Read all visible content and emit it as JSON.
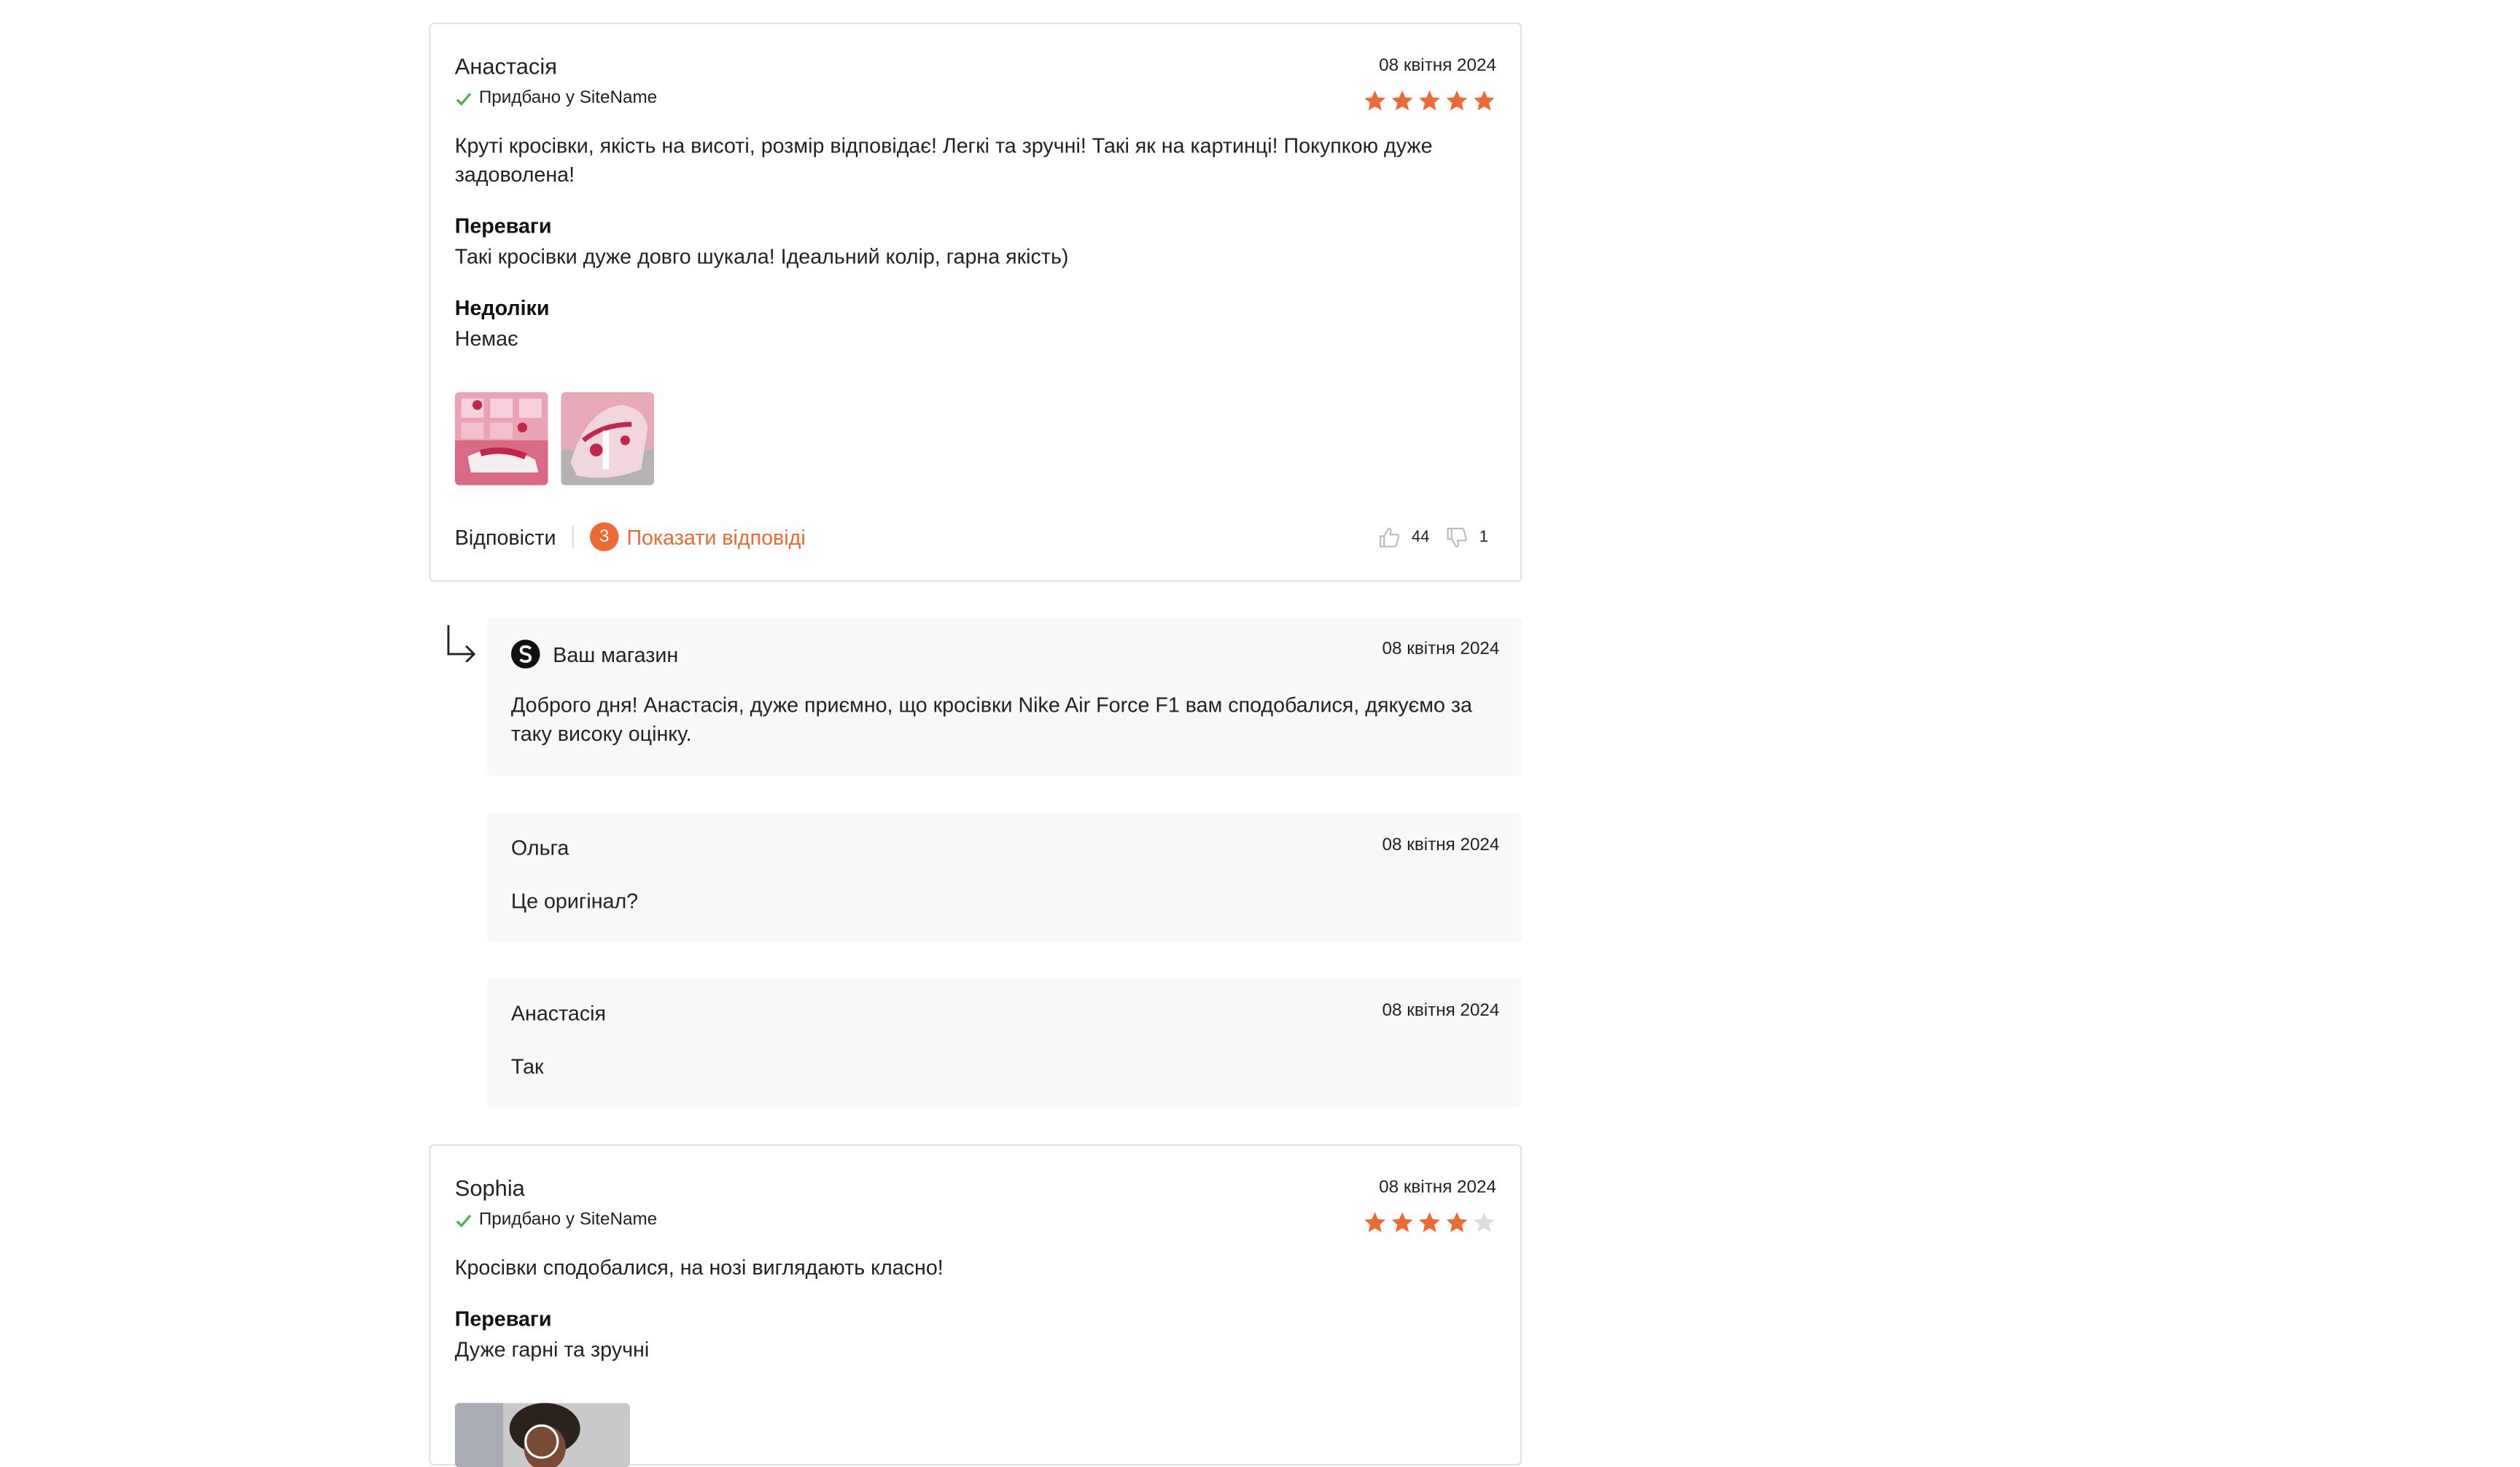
{
  "colors": {
    "accent": "#ee6a35",
    "verified": "#4caf50",
    "star_empty": "#dddddd",
    "reply_bg": "#f8f8f8"
  },
  "icons": {
    "verified": "check-icon",
    "star": "star-icon",
    "like": "thumbs-up-icon",
    "dislike": "thumbs-down-icon",
    "reply_arrow": "reply-arrow-icon",
    "shop": "shop-logo-icon",
    "video": "play-icon"
  },
  "reviews": [
    {
      "author": "Анастасія",
      "date": "08 квітня 2024",
      "verified_label": "Придбано у SiteName",
      "rating": 5,
      "text": "Круті кросівки, якість на висоті, розмір відповідає! Легкі та зручні! Такі як на картинці! Покупкою дуже задоволена!",
      "pros_title": "Переваги",
      "pros": "Такі кросівки дуже довго шукала! Ідеальний колір, гарна якість)",
      "cons_title": "Недоліки",
      "cons": "Немає",
      "photos": [
        "photo-1",
        "photo-2"
      ],
      "reply_label": "Відповісти",
      "replies_count": "3",
      "show_replies_label": "Показати відповіді",
      "likes": "44",
      "dislikes": "1"
    },
    {
      "author": "Sophia",
      "date": "08 квітня 2024",
      "verified_label": "Придбано у SiteName",
      "rating": 4,
      "text": "Кросівки сподобалися, на нозі виглядають класно!",
      "pros_title": "Переваги",
      "pros": "Дуже гарні та зручні"
    }
  ],
  "replies": [
    {
      "author": "Ваш магазин",
      "date": "08 квітня 2024",
      "text": "Доброго дня! Анастасія, дуже приємно, що кросівки Nike Air Force F1 вам сподобалися, дякуємо за таку високу оцінку."
    },
    {
      "author": "Ольга",
      "date": "08 квітня 2024",
      "text": "Це оригінал?"
    },
    {
      "author": "Анастасія",
      "date": "08 квітня 2024",
      "text": "Так"
    }
  ]
}
